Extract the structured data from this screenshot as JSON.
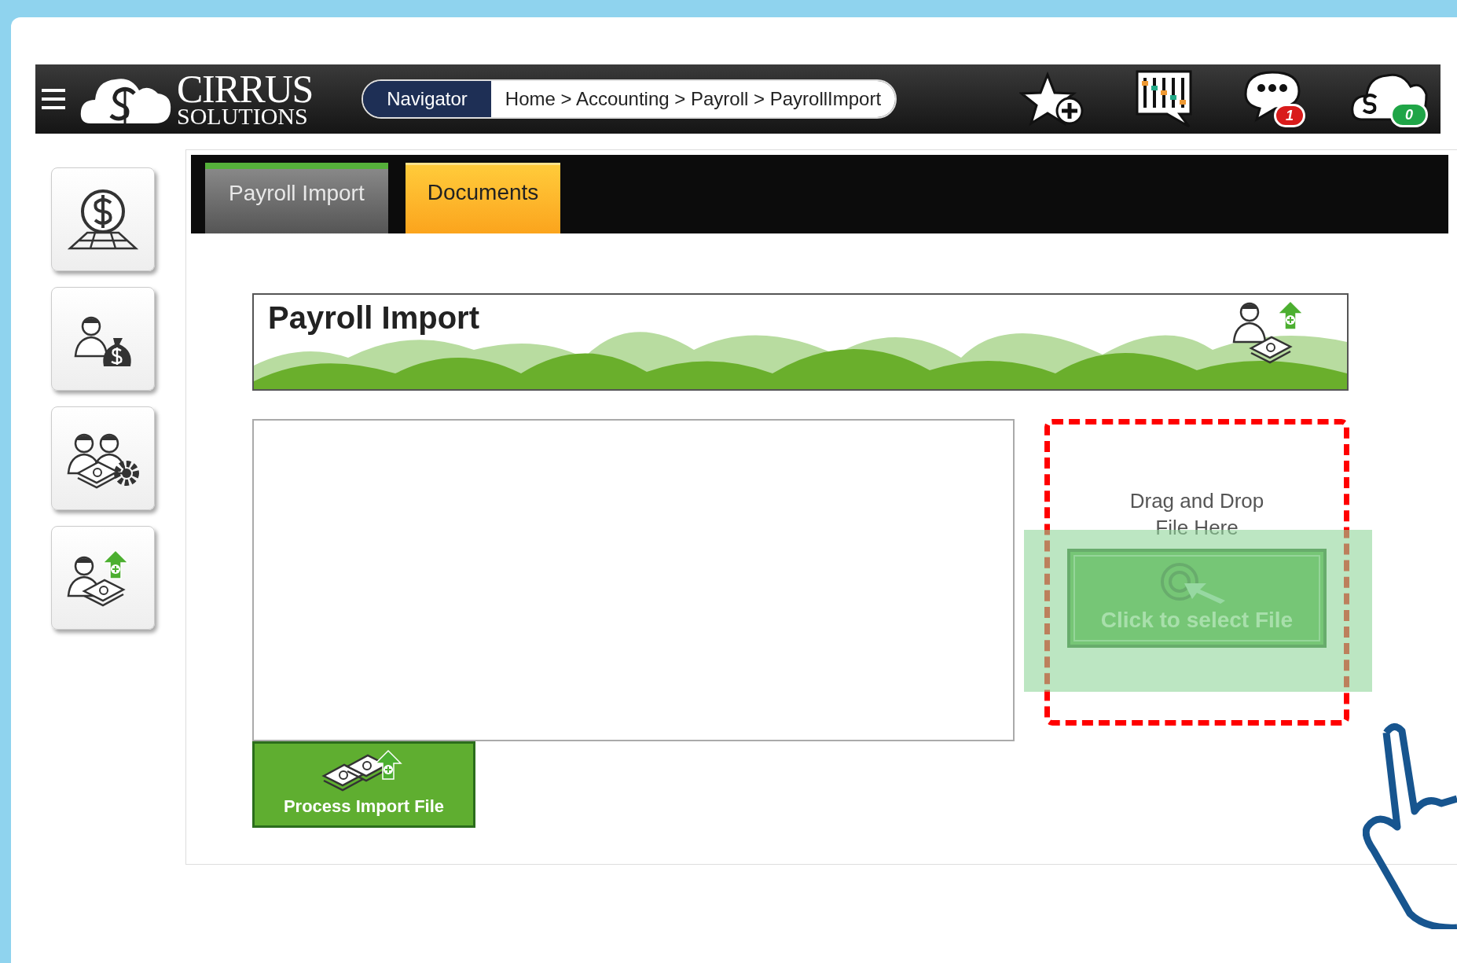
{
  "header": {
    "logo": {
      "name": "CIRRUS",
      "sub": "SOLUTIONS"
    },
    "navigator": "Navigator",
    "breadcrumb": "Home > Accounting > Payroll > PayrollImport",
    "messages_badge": "1",
    "cloud_badge": "0"
  },
  "tabs": [
    {
      "label": "Payroll Import",
      "selected": true
    },
    {
      "label": "Documents",
      "selected": false
    }
  ],
  "banner": {
    "title": "Payroll Import"
  },
  "drop_zone": {
    "hint": "Drag and Drop File Here",
    "button": "Click to select File"
  },
  "process_button": "Process Import File"
}
